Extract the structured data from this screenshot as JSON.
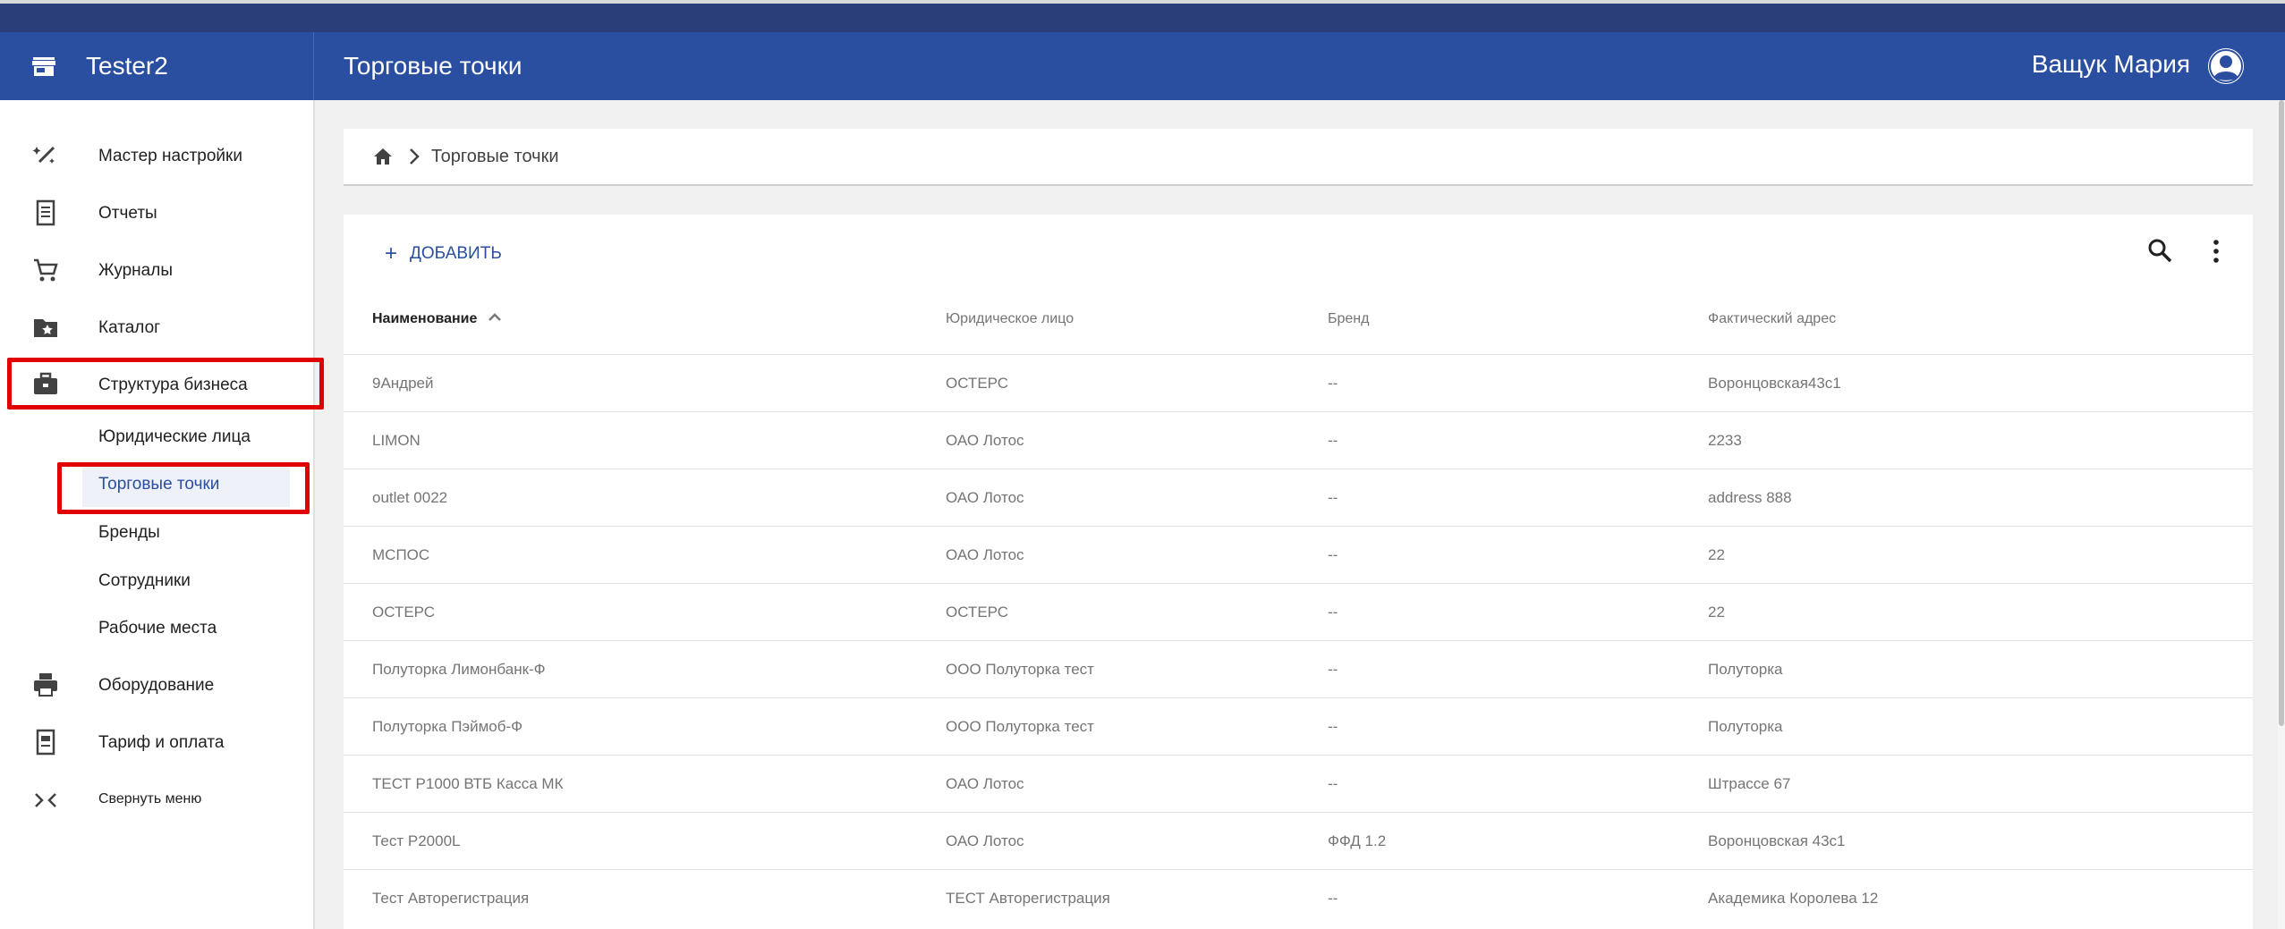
{
  "app": {
    "brand": "Tester2",
    "page_title": "Торговые точки",
    "user_name": "Ващук Мария"
  },
  "colors": {
    "appbar": "#2a4fa0",
    "highlight": "#e00000",
    "accent": "#2a4fa0"
  },
  "sidebar": {
    "items": [
      {
        "label": "Мастер настройки",
        "icon": "magic-wand-icon"
      },
      {
        "label": "Отчеты",
        "icon": "receipt-icon"
      },
      {
        "label": "Журналы",
        "icon": "cart-icon"
      },
      {
        "label": "Каталог",
        "icon": "folder-star-icon"
      },
      {
        "label": "Структура бизнеса",
        "icon": "briefcase-icon"
      },
      {
        "label": "Оборудование",
        "icon": "printer-icon"
      },
      {
        "label": "Тариф и оплата",
        "icon": "invoice-icon"
      }
    ],
    "sub_items": [
      {
        "label": "Юридические лица"
      },
      {
        "label": "Торговые точки"
      },
      {
        "label": "Бренды"
      },
      {
        "label": "Сотрудники"
      },
      {
        "label": "Рабочие места"
      }
    ],
    "collapse_label": "Свернуть меню"
  },
  "breadcrumb": {
    "current": "Торговые точки"
  },
  "toolbar": {
    "add_label": "ДОБАВИТЬ"
  },
  "table": {
    "headers": [
      "Наименование",
      "Юридическое лицо",
      "Бренд",
      "Фактический адрес"
    ],
    "rows": [
      [
        "9Андрей",
        "ОСТЕРС",
        "--",
        "Воронцовская43с1"
      ],
      [
        "LIMON",
        "ОАО Лотос",
        "--",
        "2233"
      ],
      [
        "outlet 0022",
        "ОАО Лотос",
        "--",
        "address 888"
      ],
      [
        "МСПОС",
        "ОАО Лотос",
        "--",
        "22"
      ],
      [
        "ОСТЕРС",
        "ОСТЕРС",
        "--",
        "22"
      ],
      [
        "Полуторка Лимонбанк-Ф",
        "ООО Полуторка тест",
        "--",
        "Полуторка"
      ],
      [
        "Полуторка Пэймоб-Ф",
        "ООО Полуторка тест",
        "--",
        "Полуторка"
      ],
      [
        "ТЕСТ P1000 ВТБ Касса МК",
        "ОАО Лотос",
        "--",
        "Штрассе 67"
      ],
      [
        "Тест P2000L",
        "ОАО Лотос",
        "ФФД 1.2",
        "Воронцовская 43с1"
      ],
      [
        "Тест Авторегистрация",
        "ТЕСТ Авторегистрация",
        "--",
        "Академика Королева 12"
      ]
    ]
  }
}
